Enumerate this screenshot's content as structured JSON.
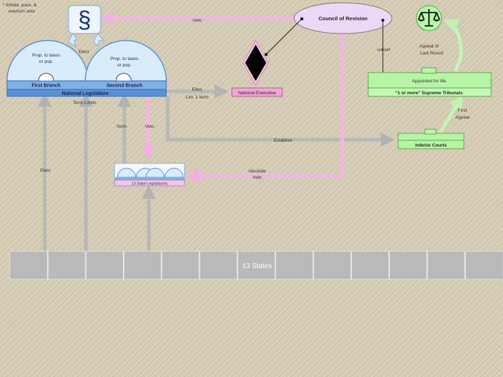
{
  "note": [
    "* initiate, pass, &",
    "overturn veto"
  ],
  "legislature": {
    "title": "National Legislature",
    "first_branch": "First Branch",
    "second_branch": "Second Branch",
    "first_dome": [
      "Prop. to taxes",
      "or pop."
    ],
    "second_dome": [
      "Prop. to taxes",
      "or pop."
    ]
  },
  "council_of_revision": "Council of Revision",
  "national_executive": "National Executive",
  "supreme_tribunals": {
    "title": "“1 or more” Supreme Tribunals",
    "appointed": "Appointed for life"
  },
  "inferior_courts": "Inferior Courts",
  "state_legislatures": "13 State Legislatures",
  "states_bar": {
    "label": "13 States"
  },
  "labels": {
    "veto_top": "Veto",
    "elect_legis": "Elect",
    "elect_exec": [
      "Elect",
      "Lim. 1 term"
    ],
    "term_limits": "Term Limits",
    "nom": "Nom.",
    "veto_states": "Veto",
    "establish": "Establish",
    "elect_states": "Elect",
    "absolute_veto": [
      "Absolute",
      "Veto"
    ],
    "subset": "subset",
    "appeal_last": [
      "Appeal of",
      "Last Resort"
    ],
    "first_appeal": [
      "First",
      "Appeal"
    ]
  },
  "colors": {
    "legislature_blue": "#7fb0e8",
    "legislature_light": "#d8ecfb",
    "executive_pink": "#f3a6d6",
    "judiciary_green": "#b7f5a6",
    "council_lavender": "#ead8f6",
    "arrow_gray": "#b8b8b8",
    "arrow_pink": "#f6b4e6",
    "arrow_green": "#c4f5b8"
  }
}
